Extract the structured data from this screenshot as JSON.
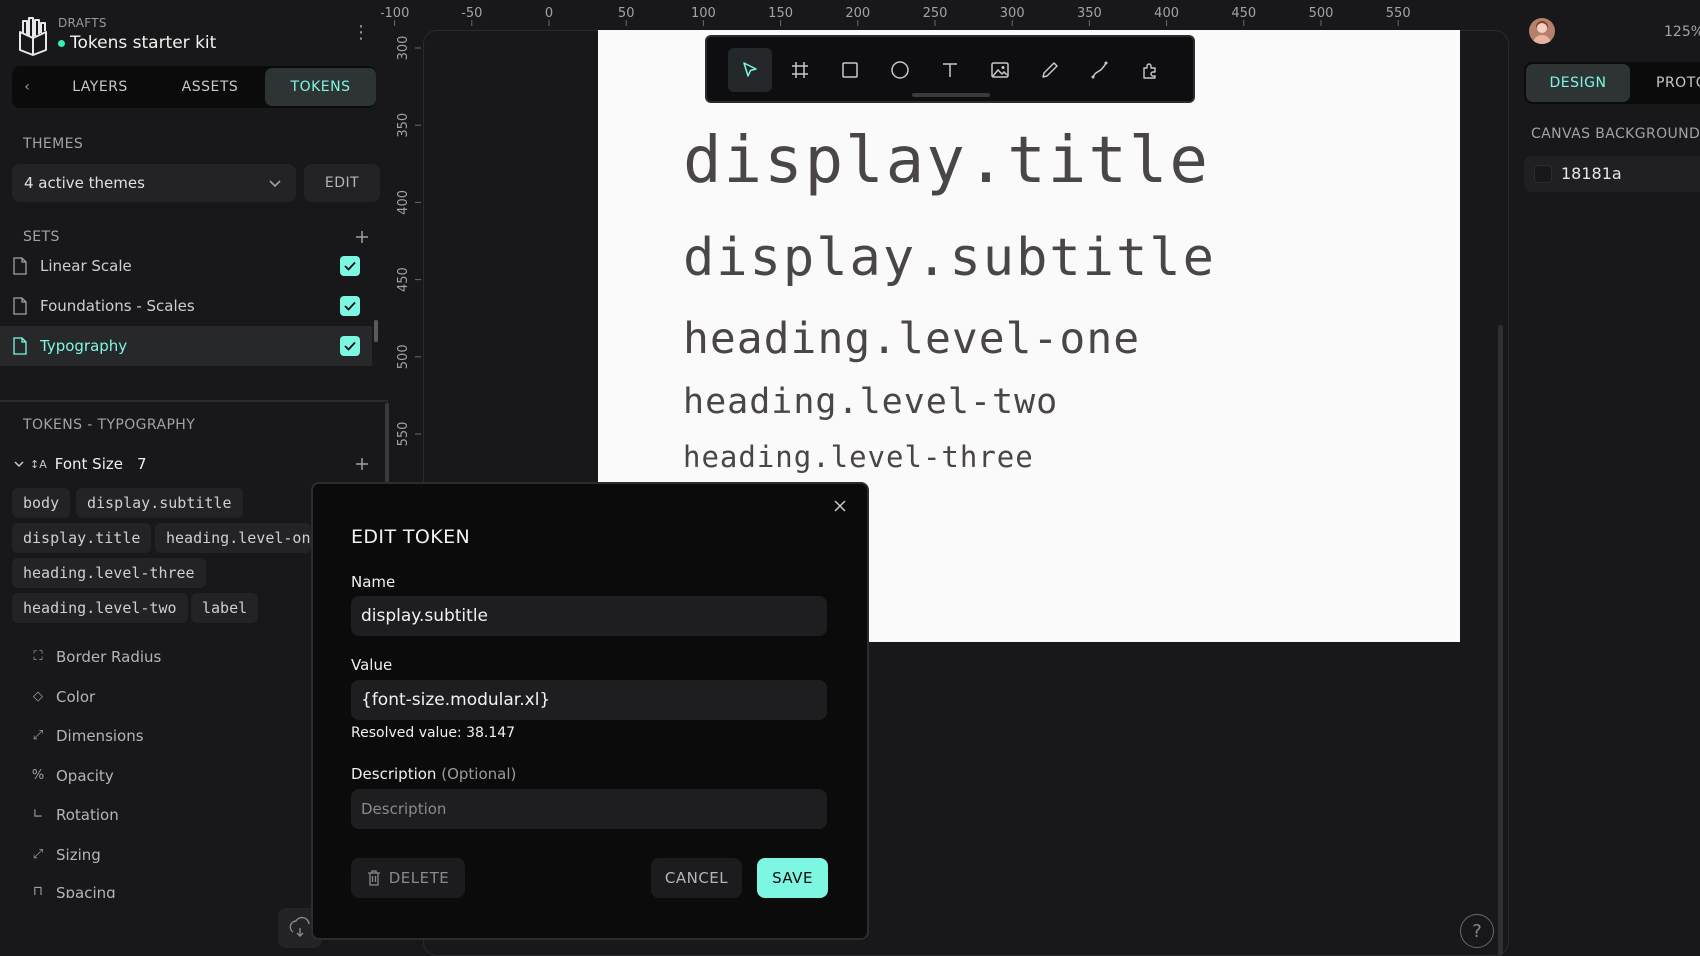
{
  "colors": {
    "accent": "#7ef7e2",
    "status_online": "#31efb8",
    "app_bg": "#18181a",
    "board_bg": "#fafafa",
    "token_text": "#4a4548"
  },
  "header": {
    "workspace": "DRAFTS",
    "project": "Tokens starter kit",
    "logo_icon": "penpot-logo-icon",
    "menu_icon": "kebab-menu-icon"
  },
  "tabs": {
    "back_icon": "chevron-left-icon",
    "items": [
      {
        "label": "LAYERS",
        "active": false
      },
      {
        "label": "ASSETS",
        "active": false
      },
      {
        "label": "TOKENS",
        "active": true
      }
    ]
  },
  "themes": {
    "heading": "THEMES",
    "selected": "4 active themes",
    "edit_label": "EDIT"
  },
  "sets": {
    "heading": "SETS",
    "items": [
      {
        "label": "Linear Scale",
        "checked": true,
        "active": false
      },
      {
        "label": "Foundations - Scales",
        "checked": true,
        "active": false
      },
      {
        "label": "Typography",
        "checked": true,
        "active": true
      }
    ]
  },
  "tokens": {
    "heading": "TOKENS - TYPOGRAPHY",
    "group": {
      "label": "Font Size",
      "count": "7",
      "pills": [
        "body",
        "display.subtitle",
        "display.title",
        "heading.level-one",
        "heading.level-three",
        "heading.level-two",
        "label"
      ]
    },
    "categories": [
      {
        "label": "Border Radius",
        "icon": "border-radius-icon"
      },
      {
        "label": "Color",
        "icon": "color-drop-icon"
      },
      {
        "label": "Dimensions",
        "icon": "dimensions-icon"
      },
      {
        "label": "Opacity",
        "icon": "percent-icon"
      },
      {
        "label": "Rotation",
        "icon": "rotation-icon"
      },
      {
        "label": "Sizing",
        "icon": "sizing-icon"
      },
      {
        "label": "Spacing",
        "icon": "spacing-icon"
      }
    ]
  },
  "rulers": {
    "x_ticks": [
      "-100",
      "-50",
      "0",
      "50",
      "100",
      "150",
      "200",
      "250",
      "300",
      "350",
      "400",
      "450",
      "500",
      "550"
    ],
    "y_ticks": [
      "300",
      "350",
      "400",
      "450",
      "500",
      "550"
    ]
  },
  "toolbar": {
    "tools": [
      "pointer-icon",
      "board-icon",
      "rectangle-icon",
      "ellipse-icon",
      "text-icon",
      "image-icon",
      "pencil-icon",
      "path-icon",
      "plugins-icon"
    ]
  },
  "canvas": {
    "texts": [
      {
        "text": "display.title"
      },
      {
        "text": "display.subtitle"
      },
      {
        "text": "heading.level-one"
      },
      {
        "text": "heading.level-two"
      },
      {
        "text": "heading.level-three"
      }
    ],
    "help_label": "?"
  },
  "right_panel": {
    "zoom": "125%",
    "tabs": [
      {
        "label": "DESIGN",
        "active": true
      },
      {
        "label": "PROTO",
        "active": false
      }
    ],
    "canvas_background_heading": "CANVAS BACKGROUND",
    "canvas_background_value": "18181a"
  },
  "modal": {
    "title": "EDIT TOKEN",
    "name_label": "Name",
    "name_value": "display.subtitle",
    "value_label": "Value",
    "value_value": "{font-size.modular.xl}",
    "resolved": "Resolved value: 38.147",
    "description_label": "Description",
    "description_optional": "(Optional)",
    "description_placeholder": "Description",
    "delete_label": "DELETE",
    "cancel_label": "CANCEL",
    "save_label": "SAVE"
  }
}
